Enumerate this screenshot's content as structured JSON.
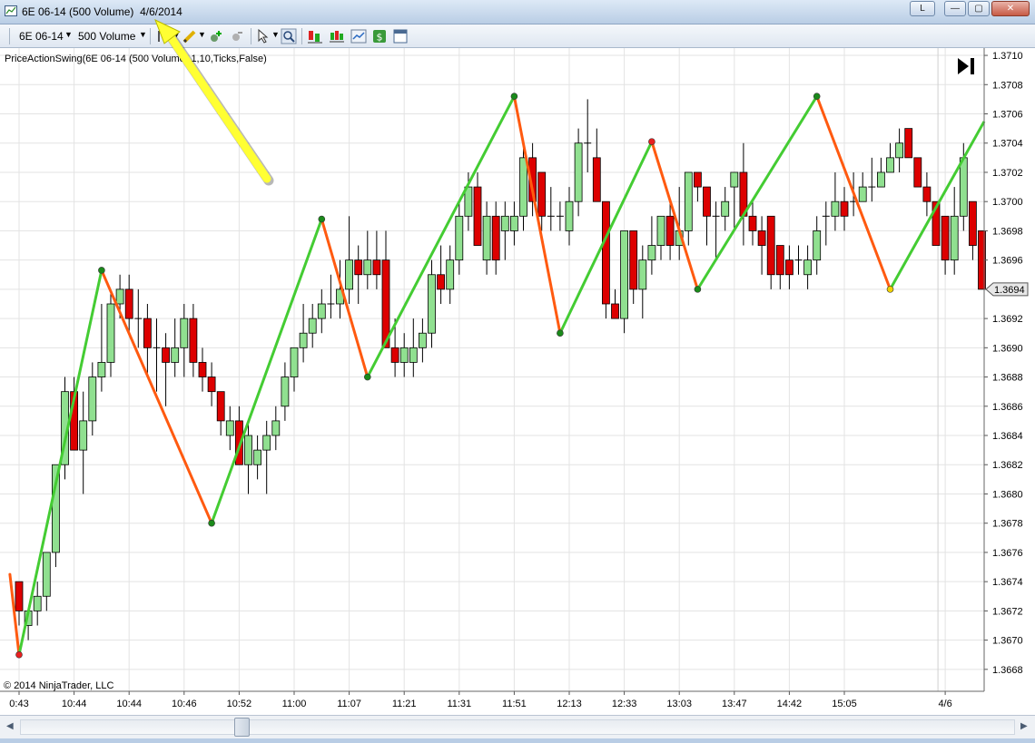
{
  "window": {
    "title_instrument": "6E 06-14 (500 Volume)",
    "title_date": "4/6/2014",
    "link_button_label": "L",
    "minimize_glyph": "—",
    "maximize_glyph": "▢",
    "close_glyph": "✕"
  },
  "toolbar": {
    "instrument": "6E 06-14",
    "interval": "500 Volume",
    "icons": [
      "bar-type-icon",
      "pencil-icon",
      "add-indicator-icon",
      "remove-indicator-icon",
      "cursor-icon",
      "zoom-icon",
      "strategies-icon",
      "chart-style-icon",
      "data-series-icon",
      "dollar-icon",
      "properties-icon"
    ]
  },
  "chart": {
    "indicator_label": "PriceActionSwing(6E 06-14 (500 Volume),1,10,Ticks,False)",
    "copyright": "© 2014 NinjaTrader, LLC",
    "current_price_label": "1.3694",
    "colors": {
      "up_candle": "#90e090",
      "down_candle": "#dd0000",
      "up_swing": "#44cc33",
      "down_swing": "#ff5a10",
      "annotation_arrow": "#ffff33"
    }
  },
  "chart_data": {
    "type": "candlestick",
    "y_ticks": [
      "1.3668",
      "1.3670",
      "1.3672",
      "1.3674",
      "1.3676",
      "1.3678",
      "1.3680",
      "1.3682",
      "1.3684",
      "1.3686",
      "1.3688",
      "1.3690",
      "1.3692",
      "1.3694",
      "1.3696",
      "1.3698",
      "1.3700",
      "1.3702",
      "1.3704",
      "1.3706",
      "1.3708",
      "1.3710"
    ],
    "ylim": [
      1.36665,
      1.37105
    ],
    "x_ticks": [
      "0:43",
      "10:44",
      "10:44",
      "10:46",
      "10:52",
      "11:00",
      "11:07",
      "11:21",
      "11:31",
      "11:51",
      "12:13",
      "12:33",
      "13:03",
      "13:47",
      "14:42",
      "15:05",
      "4/6"
    ],
    "x_tick_bar_index": [
      0,
      6,
      12,
      18,
      24,
      30,
      36,
      42,
      48,
      54,
      60,
      66,
      72,
      78,
      84,
      90,
      101
    ],
    "candles": [
      {
        "o": 1.3674,
        "h": 1.3674,
        "l": 1.3671,
        "c": 1.3672
      },
      {
        "o": 1.3671,
        "h": 1.3672,
        "l": 1.367,
        "c": 1.3672
      },
      {
        "o": 1.3672,
        "h": 1.3674,
        "l": 1.3671,
        "c": 1.3673
      },
      {
        "o": 1.3673,
        "h": 1.3676,
        "l": 1.3672,
        "c": 1.3676
      },
      {
        "o": 1.3676,
        "h": 1.3682,
        "l": 1.3675,
        "c": 1.3682
      },
      {
        "o": 1.3682,
        "h": 1.3688,
        "l": 1.3681,
        "c": 1.3687
      },
      {
        "o": 1.3687,
        "h": 1.3688,
        "l": 1.3683,
        "c": 1.3683
      },
      {
        "o": 1.3683,
        "h": 1.3687,
        "l": 1.368,
        "c": 1.3685
      },
      {
        "o": 1.3685,
        "h": 1.3689,
        "l": 1.3684,
        "c": 1.3688
      },
      {
        "o": 1.3688,
        "h": 1.3693,
        "l": 1.3687,
        "c": 1.3689
      },
      {
        "o": 1.3689,
        "h": 1.3694,
        "l": 1.3688,
        "c": 1.3693
      },
      {
        "o": 1.3693,
        "h": 1.3695,
        "l": 1.3692,
        "c": 1.3694
      },
      {
        "o": 1.3694,
        "h": 1.3695,
        "l": 1.3691,
        "c": 1.3692
      },
      {
        "o": 1.3692,
        "h": 1.3694,
        "l": 1.369,
        "c": 1.3692
      },
      {
        "o": 1.3692,
        "h": 1.3693,
        "l": 1.3688,
        "c": 1.369
      },
      {
        "o": 1.369,
        "h": 1.3692,
        "l": 1.3687,
        "c": 1.369
      },
      {
        "o": 1.369,
        "h": 1.3691,
        "l": 1.3686,
        "c": 1.3689
      },
      {
        "o": 1.3689,
        "h": 1.3692,
        "l": 1.3688,
        "c": 1.369
      },
      {
        "o": 1.369,
        "h": 1.3693,
        "l": 1.3688,
        "c": 1.3692
      },
      {
        "o": 1.3692,
        "h": 1.3693,
        "l": 1.3688,
        "c": 1.3689
      },
      {
        "o": 1.3689,
        "h": 1.369,
        "l": 1.3687,
        "c": 1.3688
      },
      {
        "o": 1.3688,
        "h": 1.3689,
        "l": 1.3686,
        "c": 1.3687
      },
      {
        "o": 1.3687,
        "h": 1.3687,
        "l": 1.3684,
        "c": 1.3685
      },
      {
        "o": 1.3684,
        "h": 1.3686,
        "l": 1.3683,
        "c": 1.3685
      },
      {
        "o": 1.3685,
        "h": 1.3686,
        "l": 1.3682,
        "c": 1.3682
      },
      {
        "o": 1.3682,
        "h": 1.3685,
        "l": 1.368,
        "c": 1.3684
      },
      {
        "o": 1.3682,
        "h": 1.3684,
        "l": 1.3681,
        "c": 1.3683
      },
      {
        "o": 1.3683,
        "h": 1.3685,
        "l": 1.368,
        "c": 1.3684
      },
      {
        "o": 1.3684,
        "h": 1.3686,
        "l": 1.3683,
        "c": 1.3685
      },
      {
        "o": 1.3686,
        "h": 1.3689,
        "l": 1.3685,
        "c": 1.3688
      },
      {
        "o": 1.3688,
        "h": 1.369,
        "l": 1.3687,
        "c": 1.369
      },
      {
        "o": 1.369,
        "h": 1.3693,
        "l": 1.3689,
        "c": 1.3691
      },
      {
        "o": 1.3691,
        "h": 1.3693,
        "l": 1.369,
        "c": 1.3692
      },
      {
        "o": 1.3692,
        "h": 1.3694,
        "l": 1.3691,
        "c": 1.3693
      },
      {
        "o": 1.3693,
        "h": 1.3695,
        "l": 1.3692,
        "c": 1.3693
      },
      {
        "o": 1.3693,
        "h": 1.3696,
        "l": 1.3692,
        "c": 1.3694
      },
      {
        "o": 1.3694,
        "h": 1.3699,
        "l": 1.3693,
        "c": 1.3696
      },
      {
        "o": 1.3696,
        "h": 1.3697,
        "l": 1.3693,
        "c": 1.3695
      },
      {
        "o": 1.3695,
        "h": 1.3698,
        "l": 1.3694,
        "c": 1.3696
      },
      {
        "o": 1.3696,
        "h": 1.3698,
        "l": 1.3694,
        "c": 1.3695
      },
      {
        "o": 1.3696,
        "h": 1.3698,
        "l": 1.369,
        "c": 1.369
      },
      {
        "o": 1.369,
        "h": 1.3692,
        "l": 1.3688,
        "c": 1.3689
      },
      {
        "o": 1.3689,
        "h": 1.3691,
        "l": 1.3688,
        "c": 1.369
      },
      {
        "o": 1.3689,
        "h": 1.3692,
        "l": 1.3688,
        "c": 1.369
      },
      {
        "o": 1.369,
        "h": 1.3692,
        "l": 1.3689,
        "c": 1.3691
      },
      {
        "o": 1.3691,
        "h": 1.3696,
        "l": 1.369,
        "c": 1.3695
      },
      {
        "o": 1.3695,
        "h": 1.3697,
        "l": 1.3693,
        "c": 1.3694
      },
      {
        "o": 1.3694,
        "h": 1.3697,
        "l": 1.3693,
        "c": 1.3696
      },
      {
        "o": 1.3696,
        "h": 1.37,
        "l": 1.3695,
        "c": 1.3699
      },
      {
        "o": 1.3699,
        "h": 1.3702,
        "l": 1.3698,
        "c": 1.3701
      },
      {
        "o": 1.3701,
        "h": 1.3702,
        "l": 1.3697,
        "c": 1.3697
      },
      {
        "o": 1.3696,
        "h": 1.37,
        "l": 1.3695,
        "c": 1.3699
      },
      {
        "o": 1.3699,
        "h": 1.37,
        "l": 1.3695,
        "c": 1.3696
      },
      {
        "o": 1.3698,
        "h": 1.37,
        "l": 1.3696,
        "c": 1.3699
      },
      {
        "o": 1.3698,
        "h": 1.37,
        "l": 1.3697,
        "c": 1.3699
      },
      {
        "o": 1.3699,
        "h": 1.3704,
        "l": 1.3698,
        "c": 1.3703
      },
      {
        "o": 1.3703,
        "h": 1.3704,
        "l": 1.3699,
        "c": 1.37
      },
      {
        "o": 1.3702,
        "h": 1.3702,
        "l": 1.3698,
        "c": 1.3699
      },
      {
        "o": 1.3699,
        "h": 1.3701,
        "l": 1.3698,
        "c": 1.3699
      },
      {
        "o": 1.3699,
        "h": 1.37,
        "l": 1.3698,
        "c": 1.3699
      },
      {
        "o": 1.3698,
        "h": 1.3701,
        "l": 1.3697,
        "c": 1.37
      },
      {
        "o": 1.37,
        "h": 1.3705,
        "l": 1.3699,
        "c": 1.3704
      },
      {
        "o": 1.3704,
        "h": 1.3707,
        "l": 1.3702,
        "c": 1.3704
      },
      {
        "o": 1.3703,
        "h": 1.3705,
        "l": 1.37,
        "c": 1.37
      },
      {
        "o": 1.37,
        "h": 1.37,
        "l": 1.3692,
        "c": 1.3693
      },
      {
        "o": 1.3693,
        "h": 1.3694,
        "l": 1.3692,
        "c": 1.3692
      },
      {
        "o": 1.3692,
        "h": 1.3698,
        "l": 1.3691,
        "c": 1.3698
      },
      {
        "o": 1.3698,
        "h": 1.3698,
        "l": 1.3693,
        "c": 1.3694
      },
      {
        "o": 1.3694,
        "h": 1.3697,
        "l": 1.3692,
        "c": 1.3696
      },
      {
        "o": 1.3696,
        "h": 1.3699,
        "l": 1.3695,
        "c": 1.3697
      },
      {
        "o": 1.3697,
        "h": 1.3699,
        "l": 1.3696,
        "c": 1.3699
      },
      {
        "o": 1.3699,
        "h": 1.37,
        "l": 1.3696,
        "c": 1.3697
      },
      {
        "o": 1.3697,
        "h": 1.3701,
        "l": 1.3696,
        "c": 1.3698
      },
      {
        "o": 1.3698,
        "h": 1.3702,
        "l": 1.3697,
        "c": 1.3702
      },
      {
        "o": 1.3702,
        "h": 1.3702,
        "l": 1.37,
        "c": 1.3701
      },
      {
        "o": 1.3701,
        "h": 1.3701,
        "l": 1.3697,
        "c": 1.3699
      },
      {
        "o": 1.3699,
        "h": 1.37,
        "l": 1.3696,
        "c": 1.3699
      },
      {
        "o": 1.3699,
        "h": 1.3701,
        "l": 1.3698,
        "c": 1.37
      },
      {
        "o": 1.3701,
        "h": 1.3702,
        "l": 1.3698,
        "c": 1.3702
      },
      {
        "o": 1.3702,
        "h": 1.3704,
        "l": 1.3697,
        "c": 1.3699
      },
      {
        "o": 1.3699,
        "h": 1.37,
        "l": 1.3697,
        "c": 1.3698
      },
      {
        "o": 1.3698,
        "h": 1.3699,
        "l": 1.3695,
        "c": 1.3697
      },
      {
        "o": 1.3699,
        "h": 1.3699,
        "l": 1.3694,
        "c": 1.3695
      },
      {
        "o": 1.3697,
        "h": 1.3697,
        "l": 1.3694,
        "c": 1.3695
      },
      {
        "o": 1.3696,
        "h": 1.3697,
        "l": 1.3694,
        "c": 1.3695
      },
      {
        "o": 1.3696,
        "h": 1.3697,
        "l": 1.3695,
        "c": 1.3696
      },
      {
        "o": 1.3695,
        "h": 1.3697,
        "l": 1.3694,
        "c": 1.3696
      },
      {
        "o": 1.3696,
        "h": 1.3699,
        "l": 1.3695,
        "c": 1.3698
      },
      {
        "o": 1.3699,
        "h": 1.37,
        "l": 1.3697,
        "c": 1.3699
      },
      {
        "o": 1.3699,
        "h": 1.3702,
        "l": 1.3698,
        "c": 1.37
      },
      {
        "o": 1.37,
        "h": 1.3701,
        "l": 1.3698,
        "c": 1.3699
      },
      {
        "o": 1.37,
        "h": 1.3702,
        "l": 1.3699,
        "c": 1.37
      },
      {
        "o": 1.37,
        "h": 1.3702,
        "l": 1.37,
        "c": 1.3701
      },
      {
        "o": 1.3701,
        "h": 1.3703,
        "l": 1.37,
        "c": 1.3701
      },
      {
        "o": 1.3701,
        "h": 1.3703,
        "l": 1.3701,
        "c": 1.3702
      },
      {
        "o": 1.3702,
        "h": 1.3704,
        "l": 1.3702,
        "c": 1.3703
      },
      {
        "o": 1.3703,
        "h": 1.3705,
        "l": 1.3702,
        "c": 1.3704
      },
      {
        "o": 1.3705,
        "h": 1.3705,
        "l": 1.3703,
        "c": 1.3703
      },
      {
        "o": 1.3703,
        "h": 1.3703,
        "l": 1.3701,
        "c": 1.3701
      },
      {
        "o": 1.3701,
        "h": 1.3702,
        "l": 1.3699,
        "c": 1.37
      },
      {
        "o": 1.37,
        "h": 1.37,
        "l": 1.3697,
        "c": 1.3697
      },
      {
        "o": 1.3699,
        "h": 1.3699,
        "l": 1.3695,
        "c": 1.3696
      },
      {
        "o": 1.3696,
        "h": 1.3701,
        "l": 1.3695,
        "c": 1.3699
      },
      {
        "o": 1.3699,
        "h": 1.3704,
        "l": 1.3698,
        "c": 1.3703
      },
      {
        "o": 1.37,
        "h": 1.37,
        "l": 1.3696,
        "c": 1.3697
      },
      {
        "o": 1.3698,
        "h": 1.3698,
        "l": 1.3694,
        "c": 1.3694
      }
    ],
    "swings": [
      {
        "bar": -1,
        "price": 1.36745
      },
      {
        "bar": 0,
        "price": 1.3669
      },
      {
        "bar": 9,
        "price": 1.36953
      },
      {
        "bar": 21,
        "price": 1.3678
      },
      {
        "bar": 33,
        "price": 1.36988
      },
      {
        "bar": 38,
        "price": 1.3688
      },
      {
        "bar": 54,
        "price": 1.37072
      },
      {
        "bar": 59,
        "price": 1.3691
      },
      {
        "bar": 69,
        "price": 1.37041
      },
      {
        "bar": 74,
        "price": 1.3694
      },
      {
        "bar": 87,
        "price": 1.37072
      },
      {
        "bar": 95,
        "price": 1.3694
      },
      {
        "bar": 100,
        "price": 1.36996
      }
    ]
  }
}
